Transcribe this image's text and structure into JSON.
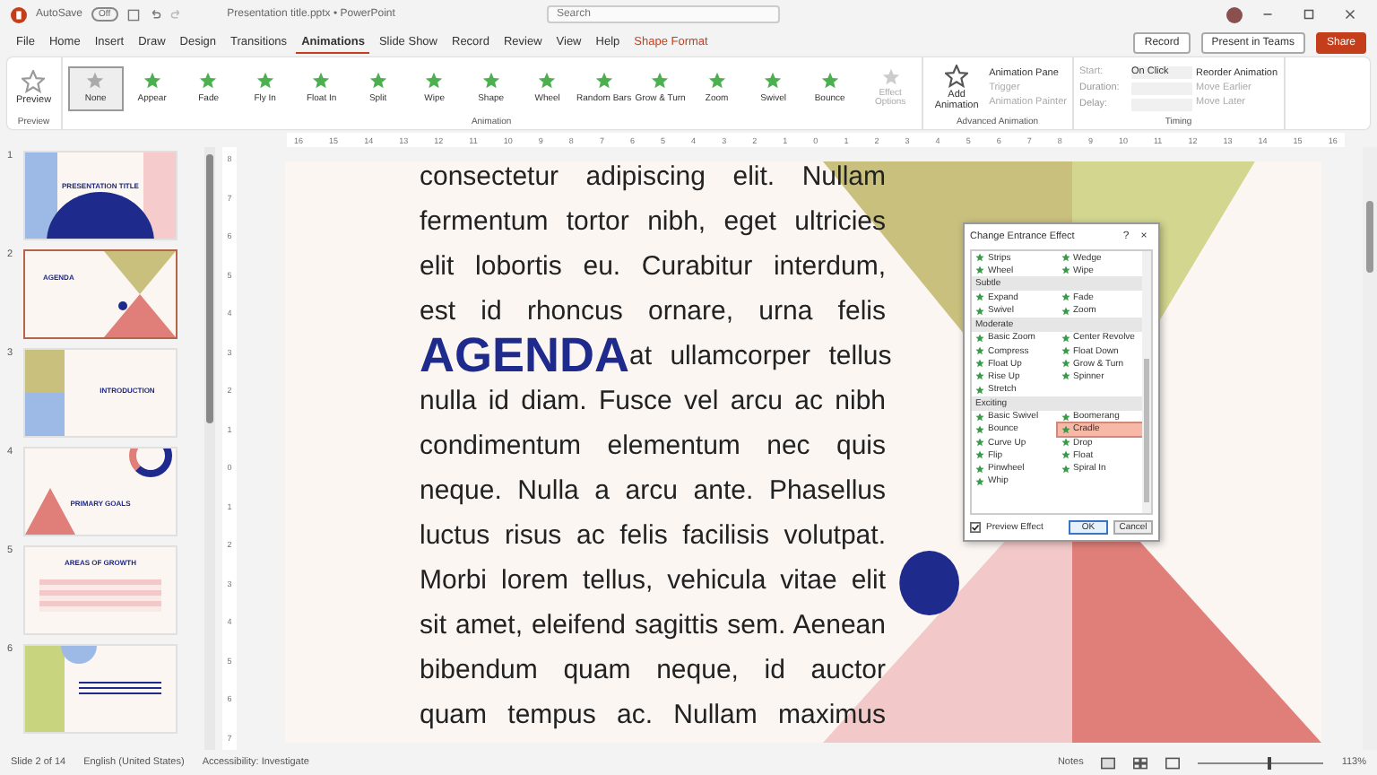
{
  "window": {
    "autosave_label": "AutoSave",
    "autosave_state": "Off",
    "title": "Presentation title.pptx • PowerPoint",
    "search_placeholder": "Search"
  },
  "tabs": [
    {
      "label": "File",
      "selected": false,
      "kind": "normal"
    },
    {
      "label": "Home",
      "selected": false,
      "kind": "normal"
    },
    {
      "label": "Insert",
      "selected": false,
      "kind": "normal"
    },
    {
      "label": "Draw",
      "selected": false,
      "kind": "normal"
    },
    {
      "label": "Design",
      "selected": false,
      "kind": "normal"
    },
    {
      "label": "Transitions",
      "selected": false,
      "kind": "normal"
    },
    {
      "label": "Animations",
      "selected": true,
      "kind": "normal"
    },
    {
      "label": "Slide Show",
      "selected": false,
      "kind": "normal"
    },
    {
      "label": "Record",
      "selected": false,
      "kind": "normal"
    },
    {
      "label": "Review",
      "selected": false,
      "kind": "normal"
    },
    {
      "label": "View",
      "selected": false,
      "kind": "normal"
    },
    {
      "label": "Help",
      "selected": false,
      "kind": "normal"
    },
    {
      "label": "Shape Format",
      "selected": false,
      "kind": "contextual"
    }
  ],
  "header_buttons": [
    {
      "label": "Record",
      "kind": "normal"
    },
    {
      "label": "Present in Teams",
      "kind": "normal"
    },
    {
      "label": "Share",
      "kind": "primary"
    }
  ],
  "ribbon": {
    "preview": {
      "label": "Preview",
      "group": "Preview"
    },
    "effects": [
      {
        "label": "None",
        "selected": true
      },
      {
        "label": "Appear",
        "selected": false
      },
      {
        "label": "Fade",
        "selected": false
      },
      {
        "label": "Fly In",
        "selected": false
      },
      {
        "label": "Float In",
        "selected": false
      },
      {
        "label": "Split",
        "selected": false
      },
      {
        "label": "Wipe",
        "selected": false
      },
      {
        "label": "Shape",
        "selected": false
      },
      {
        "label": "Wheel",
        "selected": false
      },
      {
        "label": "Random Bars",
        "selected": false
      },
      {
        "label": "Grow & Turn",
        "selected": false
      },
      {
        "label": "Zoom",
        "selected": false
      },
      {
        "label": "Swivel",
        "selected": false
      },
      {
        "label": "Bounce",
        "selected": false
      }
    ],
    "effect_options": {
      "label": "Effect Options",
      "disabled": true
    },
    "animation_group": "Animation",
    "advanced": {
      "add": "Add Animation",
      "group": "Advanced Animation",
      "items": [
        {
          "label": "Animation Pane",
          "disabled": false
        },
        {
          "label": "Trigger",
          "disabled": true
        },
        {
          "label": "Animation Painter",
          "disabled": true
        }
      ]
    },
    "timing": {
      "group": "Timing",
      "rows": [
        {
          "label": "Start:",
          "value": "On Click"
        },
        {
          "label": "Duration:"
        },
        {
          "label": "Delay:"
        }
      ],
      "reorder": "Reorder Animation",
      "moves": [
        {
          "label": "Move Earlier",
          "disabled": true
        },
        {
          "label": "Move Later",
          "disabled": true
        }
      ]
    }
  },
  "ruler": {
    "horizontal": [
      "16",
      "15",
      "14",
      "13",
      "12",
      "11",
      "10",
      "9",
      "8",
      "7",
      "6",
      "5",
      "4",
      "3",
      "2",
      "1",
      "0",
      "1",
      "2",
      "3",
      "4",
      "5",
      "6",
      "7",
      "8",
      "9",
      "10",
      "11",
      "12",
      "13",
      "14",
      "15",
      "16"
    ],
    "vertical": [
      "8",
      "7",
      "6",
      "5",
      "4",
      "3",
      "2",
      "1",
      "0",
      "1",
      "2",
      "3",
      "4",
      "5",
      "6",
      "7"
    ]
  },
  "thumbnails": [
    {
      "number": "1",
      "title": "PRESENTATION TITLE",
      "kind": "title",
      "selected": false
    },
    {
      "number": "2",
      "title": "AGENDA",
      "kind": "agenda",
      "selected": true
    },
    {
      "number": "3",
      "title": "INTRODUCTION",
      "kind": "intro",
      "selected": false
    },
    {
      "number": "4",
      "title": "PRIMARY GOALS",
      "kind": "goals",
      "selected": false
    },
    {
      "number": "5",
      "title": "AREAS OF GROWTH",
      "kind": "table",
      "selected": false
    },
    {
      "number": "6",
      "kind": "quote",
      "selected": false
    }
  ],
  "slide": {
    "lines_before": [
      "consectetur adipiscing elit. Nullam",
      "fermentum tortor nibh, eget ultricies",
      "elit lobortis eu. Curabitur interdum,",
      "est id rhoncus ornare, urna felis"
    ],
    "heading_row": {
      "heading": "AGENDA",
      "text": "at ullamcorper tellus"
    },
    "body_lines": [
      "nulla id diam. Fusce vel arcu ac nibh",
      "condimentum elementum nec quis",
      "neque. Nulla a arcu ante. Phasellus",
      "luctus risus ac felis facilisis volutpat.",
      "Morbi lorem tellus, vehicula vitae elit",
      "sit amet, eleifend sagittis sem. Aenean",
      "bibendum quam neque, id auctor",
      "quam tempus ac. Nullam maximus"
    ]
  },
  "dialog": {
    "title": "Change Entrance Effect",
    "help": "?",
    "close": "×",
    "sections": [
      {
        "items": [
          {
            "label": "Strips",
            "selected": false
          },
          {
            "label": "Wedge",
            "selected": false
          },
          {
            "label": "Wheel",
            "selected": false
          },
          {
            "label": "Wipe",
            "selected": false
          }
        ]
      },
      {
        "heading": "Subtle",
        "items": [
          {
            "label": "Expand",
            "selected": false
          },
          {
            "label": "Fade",
            "selected": false
          },
          {
            "label": "Swivel",
            "selected": false
          },
          {
            "label": "Zoom",
            "selected": false
          }
        ]
      },
      {
        "heading": "Moderate",
        "items": [
          {
            "label": "Basic Zoom",
            "selected": false
          },
          {
            "label": "Center Revolve",
            "selected": false
          },
          {
            "label": "Compress",
            "selected": false
          },
          {
            "label": "Float Down",
            "selected": false
          },
          {
            "label": "Float Up",
            "selected": false
          },
          {
            "label": "Grow & Turn",
            "selected": false
          },
          {
            "label": "Rise Up",
            "selected": false
          },
          {
            "label": "Spinner",
            "selected": false
          },
          {
            "label": "Stretch",
            "selected": false
          }
        ]
      },
      {
        "heading": "Exciting",
        "items": [
          {
            "label": "Basic Swivel",
            "selected": false
          },
          {
            "label": "Boomerang",
            "selected": false
          },
          {
            "label": "Bounce",
            "selected": false
          },
          {
            "label": "Cradle",
            "selected": true
          },
          {
            "label": "Curve Up",
            "selected": false
          },
          {
            "label": "Drop",
            "selected": false
          },
          {
            "label": "Flip",
            "selected": false
          },
          {
            "label": "Float",
            "selected": false
          },
          {
            "label": "Pinwheel",
            "selected": false
          },
          {
            "label": "Spiral In",
            "selected": false
          },
          {
            "label": "Whip",
            "selected": false
          }
        ]
      }
    ],
    "preview": {
      "label": "Preview Effect",
      "checked": true
    },
    "buttons": [
      {
        "label": "OK",
        "kind": "default"
      },
      {
        "label": "Cancel",
        "kind": "normal"
      }
    ]
  },
  "status": {
    "slide": "Slide 2 of 14",
    "language": "English (United States)",
    "accessibility": "Accessibility: Investigate",
    "notes": "Notes",
    "zoom": "113%",
    "level": 0.55
  }
}
